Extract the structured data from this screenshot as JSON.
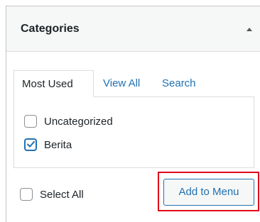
{
  "header": {
    "title": "Categories",
    "toggle_icon": "caret-up-icon"
  },
  "tabs": [
    {
      "label": "Most Used",
      "active": true
    },
    {
      "label": "View All",
      "active": false
    },
    {
      "label": "Search",
      "active": false
    }
  ],
  "categories": [
    {
      "label": "Uncategorized",
      "checked": false
    },
    {
      "label": "Berita",
      "checked": true
    }
  ],
  "footer": {
    "select_all_label": "Select All",
    "select_all_checked": false,
    "add_button_label": "Add to Menu"
  },
  "colors": {
    "link": "#2271b1",
    "highlight": "#e0001b",
    "header_bg": "#f6f7f7"
  }
}
